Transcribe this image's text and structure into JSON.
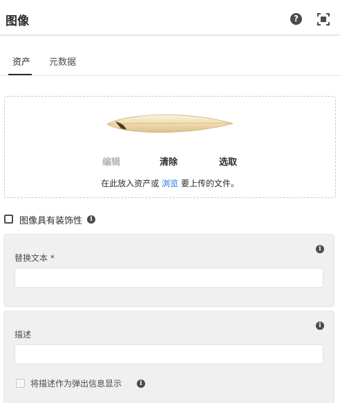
{
  "header": {
    "title": "图像",
    "help_icon": "help-icon",
    "fullscreen_icon": "fullscreen-icon"
  },
  "tabs": [
    {
      "label": "资产",
      "active": true
    },
    {
      "label": "元数据",
      "active": false
    }
  ],
  "dropzone": {
    "edit_label": "编辑",
    "clear_label": "清除",
    "pick_label": "选取",
    "hint_before": "在此放入资产或",
    "browse_link": "浏览",
    "hint_after": "要上传的文件。"
  },
  "decorative": {
    "label": "图像具有装饰性",
    "checked": false
  },
  "alt_text": {
    "label": "替换文本 *",
    "value": ""
  },
  "description": {
    "label": "描述",
    "value": "",
    "popup_label": "将描述作为弹出信息显示",
    "popup_checked": false
  },
  "colors": {
    "accent": "#1473e6",
    "panel": "#f0f0f0",
    "text": "#2c2c2c"
  }
}
